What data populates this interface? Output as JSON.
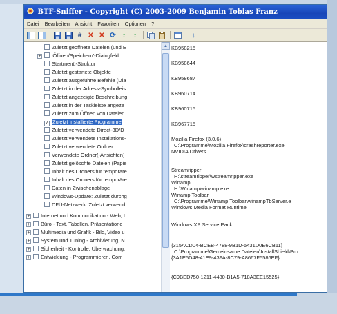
{
  "window": {
    "title": "BTF-Sniffer - Copyright (C) 2003-2009 Benjamin Tobias Franz"
  },
  "menu": [
    "Datei",
    "Bearbeiten",
    "Ansicht",
    "Favoriten",
    "Optionen",
    "?"
  ],
  "toolbar": [
    {
      "icon": "panel-left-icon"
    },
    {
      "icon": "panel-right-icon"
    },
    {
      "sep": true
    },
    {
      "icon": "save-icon"
    },
    {
      "icon": "save-all-icon"
    },
    {
      "icon": "find-icon",
      "glyph": "#"
    },
    {
      "icon": "delete-selected-icon",
      "glyph": "✕"
    },
    {
      "icon": "delete-all-icon",
      "glyph": "✕"
    },
    {
      "icon": "refresh-icon",
      "glyph": "⟳"
    },
    {
      "icon": "sort-asc-icon",
      "glyph": "↕"
    },
    {
      "icon": "sort-desc-icon",
      "glyph": "↕"
    },
    {
      "sep": true
    },
    {
      "icon": "copy-icon"
    },
    {
      "icon": "paste-icon"
    },
    {
      "sep": true
    },
    {
      "icon": "window-icon"
    },
    {
      "sep": true
    },
    {
      "icon": "down-arrow-icon",
      "glyph": "↓"
    }
  ],
  "tree": [
    {
      "label": "Zuletzt geöffnete Dateien (und E",
      "indent": 1,
      "checked": false
    },
    {
      "label": "'Öffnen/Speichern'-Dialogfeld",
      "indent": 1,
      "checked": false,
      "expander": "+"
    },
    {
      "label": "Startmenü-Struktur",
      "indent": 1,
      "checked": false
    },
    {
      "label": "Zuletzt gestartete Objekte",
      "indent": 1,
      "checked": false
    },
    {
      "label": "Zuletzt ausgeführte Befehle (Dia",
      "indent": 1,
      "checked": false
    },
    {
      "label": "Zuletzt in der Adress-Symbolleis",
      "indent": 1,
      "checked": false
    },
    {
      "label": "Zuletzt angezeigte Beschreibung",
      "indent": 1,
      "checked": false
    },
    {
      "label": "Zuletzt in der Taskleiste angeze",
      "indent": 1,
      "checked": false
    },
    {
      "label": "Zuletzt zum Öffnen von Dateien",
      "indent": 1,
      "checked": false
    },
    {
      "label": "Zuletzt installierte Programme",
      "indent": 1,
      "checked": true,
      "selected": true
    },
    {
      "label": "Zuletzt verwendete Direct-3D/D",
      "indent": 1,
      "checked": false
    },
    {
      "label": "Zuletzt verwendete Installations-",
      "indent": 1,
      "checked": false
    },
    {
      "label": "Zuletzt verwendete Ordner",
      "indent": 1,
      "checked": false
    },
    {
      "label": "Verwendete Ordner(-Ansichten)",
      "indent": 1,
      "checked": false
    },
    {
      "label": "Zuletzt gelöschte Dateien (Papie",
      "indent": 1,
      "checked": false
    },
    {
      "label": "Inhalt des Ordners für temporäre",
      "indent": 1,
      "checked": false
    },
    {
      "label": "Inhalt des Ordners für temporäre",
      "indent": 1,
      "checked": false
    },
    {
      "label": "Daten in Zwischenablage",
      "indent": 1,
      "checked": false
    },
    {
      "label": "Windows-Update: Zuletzt durchg",
      "indent": 1,
      "checked": false
    },
    {
      "label": "DFÜ-Netzwerk: Zuletzt verwend",
      "indent": 1,
      "checked": false
    },
    {
      "label": "Internet und Kommunikation - Web, I",
      "indent": 0,
      "checked": false,
      "expander": "+"
    },
    {
      "label": "Büro - Text, Tabellen, Präsentatione",
      "indent": 0,
      "checked": false,
      "expander": "+"
    },
    {
      "label": "Multimedia und Grafik - Bild, Video u",
      "indent": 0,
      "checked": false,
      "expander": "+"
    },
    {
      "label": "System und Tuning - Archivierung, N",
      "indent": 0,
      "checked": false,
      "expander": "+"
    },
    {
      "label": "Sicherheit - Kontrolle, Überwachung,",
      "indent": 0,
      "checked": false,
      "expander": "+"
    },
    {
      "label": "Entwicklung - Programmieren, Com",
      "indent": 0,
      "checked": false,
      "expander": "+"
    }
  ],
  "details": [
    {
      "text": "KB958215",
      "indent": false
    },
    {
      "text": "KB958644",
      "indent": false
    },
    {
      "text": "KB958687",
      "indent": false
    },
    {
      "text": "KB960714",
      "indent": false
    },
    {
      "text": "KB960715",
      "indent": false
    },
    {
      "text": "KB967715",
      "indent": false
    },
    {
      "text": "Mozilla Firefox (3.0.6)",
      "indent": false
    },
    {
      "text": "C:\\Programme\\Mozilla Firefox\\crashreporter.exe",
      "indent": true
    },
    {
      "text": "NVIDIA Drivers",
      "indent": false
    },
    {
      "text": "Streamripper",
      "indent": false
    },
    {
      "text": "H:\\streamripper\\wstreamripper.exe",
      "indent": true
    },
    {
      "text": "Winamp",
      "indent": false
    },
    {
      "text": "H:\\Winamp\\winamp.exe",
      "indent": true
    },
    {
      "text": "Winamp Toolbar",
      "indent": false
    },
    {
      "text": "C:\\Programme\\Winamp Toolbar\\winampTbServer.e",
      "indent": true
    },
    {
      "text": "Windows Media Format Runtime",
      "indent": false
    },
    {
      "text": "Windows XP Service Pack",
      "indent": false
    },
    {
      "text": "{315ACD04-BCEB-4788-9B1D-5431D0E6CB11}",
      "indent": false
    },
    {
      "text": "C:\\Programme\\Gemeinsame Dateien\\InstallShield\\Pro",
      "indent": true
    },
    {
      "text": "{3A1E5D48-41E9-43FA-8C79-A8667F5586EF}",
      "indent": false
    },
    {
      "text": "{C9BED750-1211-4480-B1A5-718A3EE15525}",
      "indent": false
    }
  ]
}
